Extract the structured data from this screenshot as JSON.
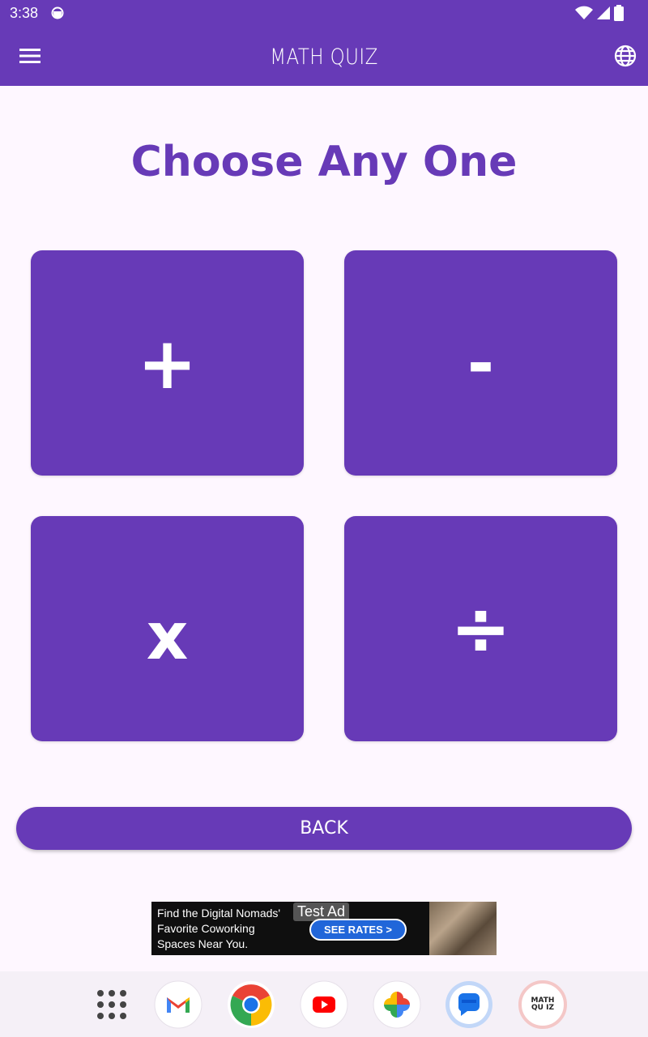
{
  "status": {
    "time": "3:38"
  },
  "app_bar": {
    "title": "MATH QUIZ"
  },
  "heading": "Choose Any One",
  "operations": [
    {
      "symbol": "+",
      "operation": "addition"
    },
    {
      "symbol": "-",
      "operation": "subtraction"
    },
    {
      "symbol": "x",
      "operation": "multiplication"
    },
    {
      "symbol": "÷",
      "operation": "division"
    }
  ],
  "back_label": "BACK",
  "ad": {
    "text": "Find the Digital Nomads' Favorite Coworking Spaces Near You.",
    "label": "Test Ad",
    "cta": "SEE RATES >"
  },
  "dock_app_label": "MATH QU IZ",
  "colors": {
    "primary": "#673ab7",
    "background": "#fef7ff"
  },
  "icons": [
    "menu-icon",
    "globe-icon",
    "wifi-icon",
    "signal-icon",
    "battery-icon",
    "apps-grid-icon",
    "gmail-icon",
    "chrome-icon",
    "youtube-icon",
    "photos-icon",
    "messages-icon",
    "math-quiz-app-icon"
  ]
}
